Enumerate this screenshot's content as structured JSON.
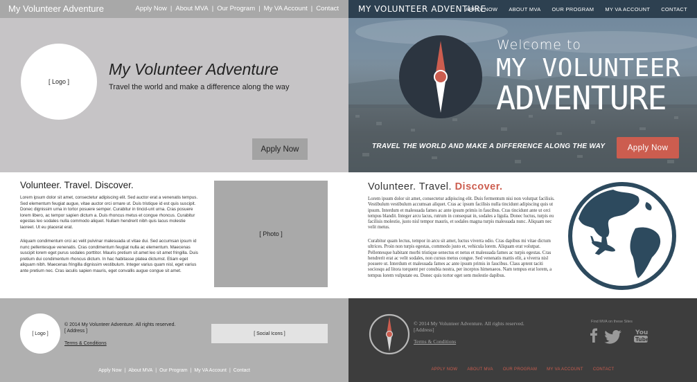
{
  "wireframe": {
    "nav": {
      "brand": "My Volunteer Adventure",
      "links": [
        "Apply Now",
        "About MVA",
        "Our Program",
        "My VA Account",
        "Contact"
      ]
    },
    "hero": {
      "logo_placeholder": "[ Logo ]",
      "title": "My Volunteer Adventure",
      "subtitle": "Travel the world and make a difference along the way",
      "apply_button": "Apply Now"
    },
    "main": {
      "heading": "Volunteer.  Travel.  Discover.",
      "paragraph1": "Lorem ipsum dolor sit amet, consectetur adipiscing elit. Sed auctor erat a venenatis tempus. Sed elementum feugiat augue, vitae auctor orci ornare ut. Duis tristique id est quis suscipit. Donec dignissim urna in tortor posuere semper. Curabitur in tincid-unt urna. Cras posuere lorem libero, ac tempor sapien dictum a. Duis rhoncus metus et congue rhoncus. Curabitur egestas leo sodales nulla commodo aliquet. Nullam hendrerit nibh quis lacus molestie laoreet. Ut eu placerat erat.",
      "paragraph2": "Aliquam condimentum orci ac velit pulvinar malesuada ut vitae dui. Sed accumsan ipsum id nunc pellentesque venenatis. Cras condimentum feugiat nulla ac elementum. Maecenas suscipit lorem eget purus sodales porttitor. Mauris pretium sit amet leo sit amet fringilla. Duis pretium dui condimentum rhoncus dictum. In hac habitasse platea dictumst. Etiam eget aliquam nibh. Maecenas fringilla dignissim vestibulum. Integer varius quam nisl, eget varius ante pretium nec. Cras iaculis sapien mauris, eget convallis augue congue sit amet.",
      "photo_placeholder": "[ Photo ]"
    },
    "footer": {
      "logo_placeholder": "[ Logo ]",
      "copyright": "© 2014 My Volunteer Adventure.  All rights reserved.",
      "address": "[ Address ]",
      "terms": "Terms & Conditions",
      "social_placeholder": "[ Social Icons ]",
      "links": [
        "Apply Now",
        "About MVA",
        "Our Program",
        "My VA Account",
        "Contact"
      ]
    }
  },
  "final": {
    "nav": {
      "brand": "MY VOLUNTEER ADVENTURE",
      "links": [
        "APPLY NOW",
        "ABOUT MVA",
        "OUR PROGRAM",
        "MY VA ACCOUNT",
        "CONTACT"
      ]
    },
    "hero": {
      "welcome_line1": "Welcome to",
      "welcome_line2": "MY VOLUNTEER",
      "welcome_line3": "ADVENTURE",
      "tagline": "TRAVEL THE WORLD AND MAKE A DIFFERENCE ALONG THE WAY",
      "apply_button": "Apply Now"
    },
    "main": {
      "heading_plain": "Volunteer.  Travel.  ",
      "heading_accent": "Discover.",
      "paragraph1": "Lorem ipsum dolor sit amet, consectetur adipiscing elit. Duis fermentum nisi non volutpat facilisis. Vestibulum vestibulum accumsan aliquet. Cras ac ipsum facilisis nulla tincidunt adipiscing quis ut ipsum. Interdum et malesuada fames ac ante ipsum primis in faucibus. Cras tincidunt ante ut orci tempus blandit. Integer arcu lacus, rutrum in consequat in, sodales a ligula. Donec luctus, turpis eu facilisis molestie, justo nisl tempor mauris, et sodales magna turpis malesuada nunc. Aliquam nec velit metus.",
      "paragraph2": "Curabitur quam lectus, tempor in arcu sit amet, luctus viverra odio. Cras dapibus mi vitae dictum ultrices. Proin non turpis egestas, commodo justo et, vehicula lorem. Aliquam erat volutpat. Pellentesque habitant morbi tristique senectus et netus et malesuada fames ac turpis egestas. Cras hendrerit erat ac velit sodales, non cursus metus congue. Sed venenatis mattis elit, a viverra nisl posuere ut. Interdum et malesuada fames ac ante ipsum primis in faucibus. Class aptent taciti sociosqu ad litora torquent per conubia nostra, per inceptos himenaeos. Nam tempus erat lorem, a tempus lorem vulputate eu. Donec quis tortor eget sem molestie dapibus."
    },
    "footer": {
      "copyright": "© 2014 My Volunteer Adventure.   All rights reserved.",
      "address": "[Address]",
      "terms": "Terms & Conditions",
      "find_label": "Find MVA on these Sites",
      "links": [
        "APPLY NOW",
        "ABOUT MVA",
        "OUR PROGRAM",
        "MY VA ACCOUNT",
        "CONTACT"
      ]
    },
    "colors": {
      "navy": "#2d4050",
      "accent": "#cc5d4f",
      "footer_bg": "#3d3d3d"
    },
    "icons": [
      "compass-logo-icon",
      "globe-airplane-icon",
      "facebook-icon",
      "twitter-icon",
      "youtube-icon"
    ]
  }
}
